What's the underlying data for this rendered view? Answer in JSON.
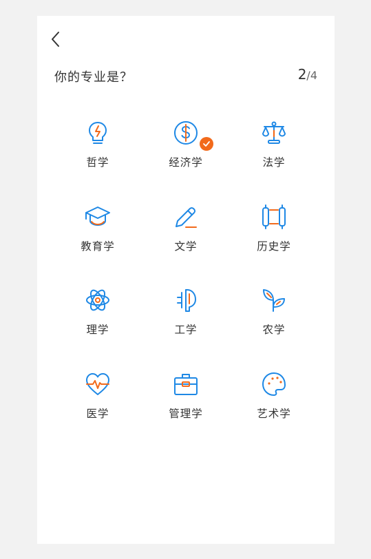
{
  "header": {
    "question": "你的专业是？",
    "progress_current": "2",
    "progress_total": "/4"
  },
  "colors": {
    "icon_blue": "#1e88e5",
    "accent_orange": "#f26a1b"
  },
  "majors": [
    {
      "label": "哲学",
      "icon": "lightbulb-icon",
      "selected": false
    },
    {
      "label": "经济学",
      "icon": "dollar-coin-icon",
      "selected": true
    },
    {
      "label": "法学",
      "icon": "scales-icon",
      "selected": false
    },
    {
      "label": "教育学",
      "icon": "graduation-cap-icon",
      "selected": false
    },
    {
      "label": "文学",
      "icon": "pencil-icon",
      "selected": false
    },
    {
      "label": "历史学",
      "icon": "scroll-icon",
      "selected": false
    },
    {
      "label": "理学",
      "icon": "atom-icon",
      "selected": false
    },
    {
      "label": "工学",
      "icon": "engineering-icon",
      "selected": false
    },
    {
      "label": "农学",
      "icon": "sprout-icon",
      "selected": false
    },
    {
      "label": "医学",
      "icon": "heartbeat-icon",
      "selected": false
    },
    {
      "label": "管理学",
      "icon": "briefcase-icon",
      "selected": false
    },
    {
      "label": "艺术学",
      "icon": "palette-icon",
      "selected": false
    }
  ]
}
